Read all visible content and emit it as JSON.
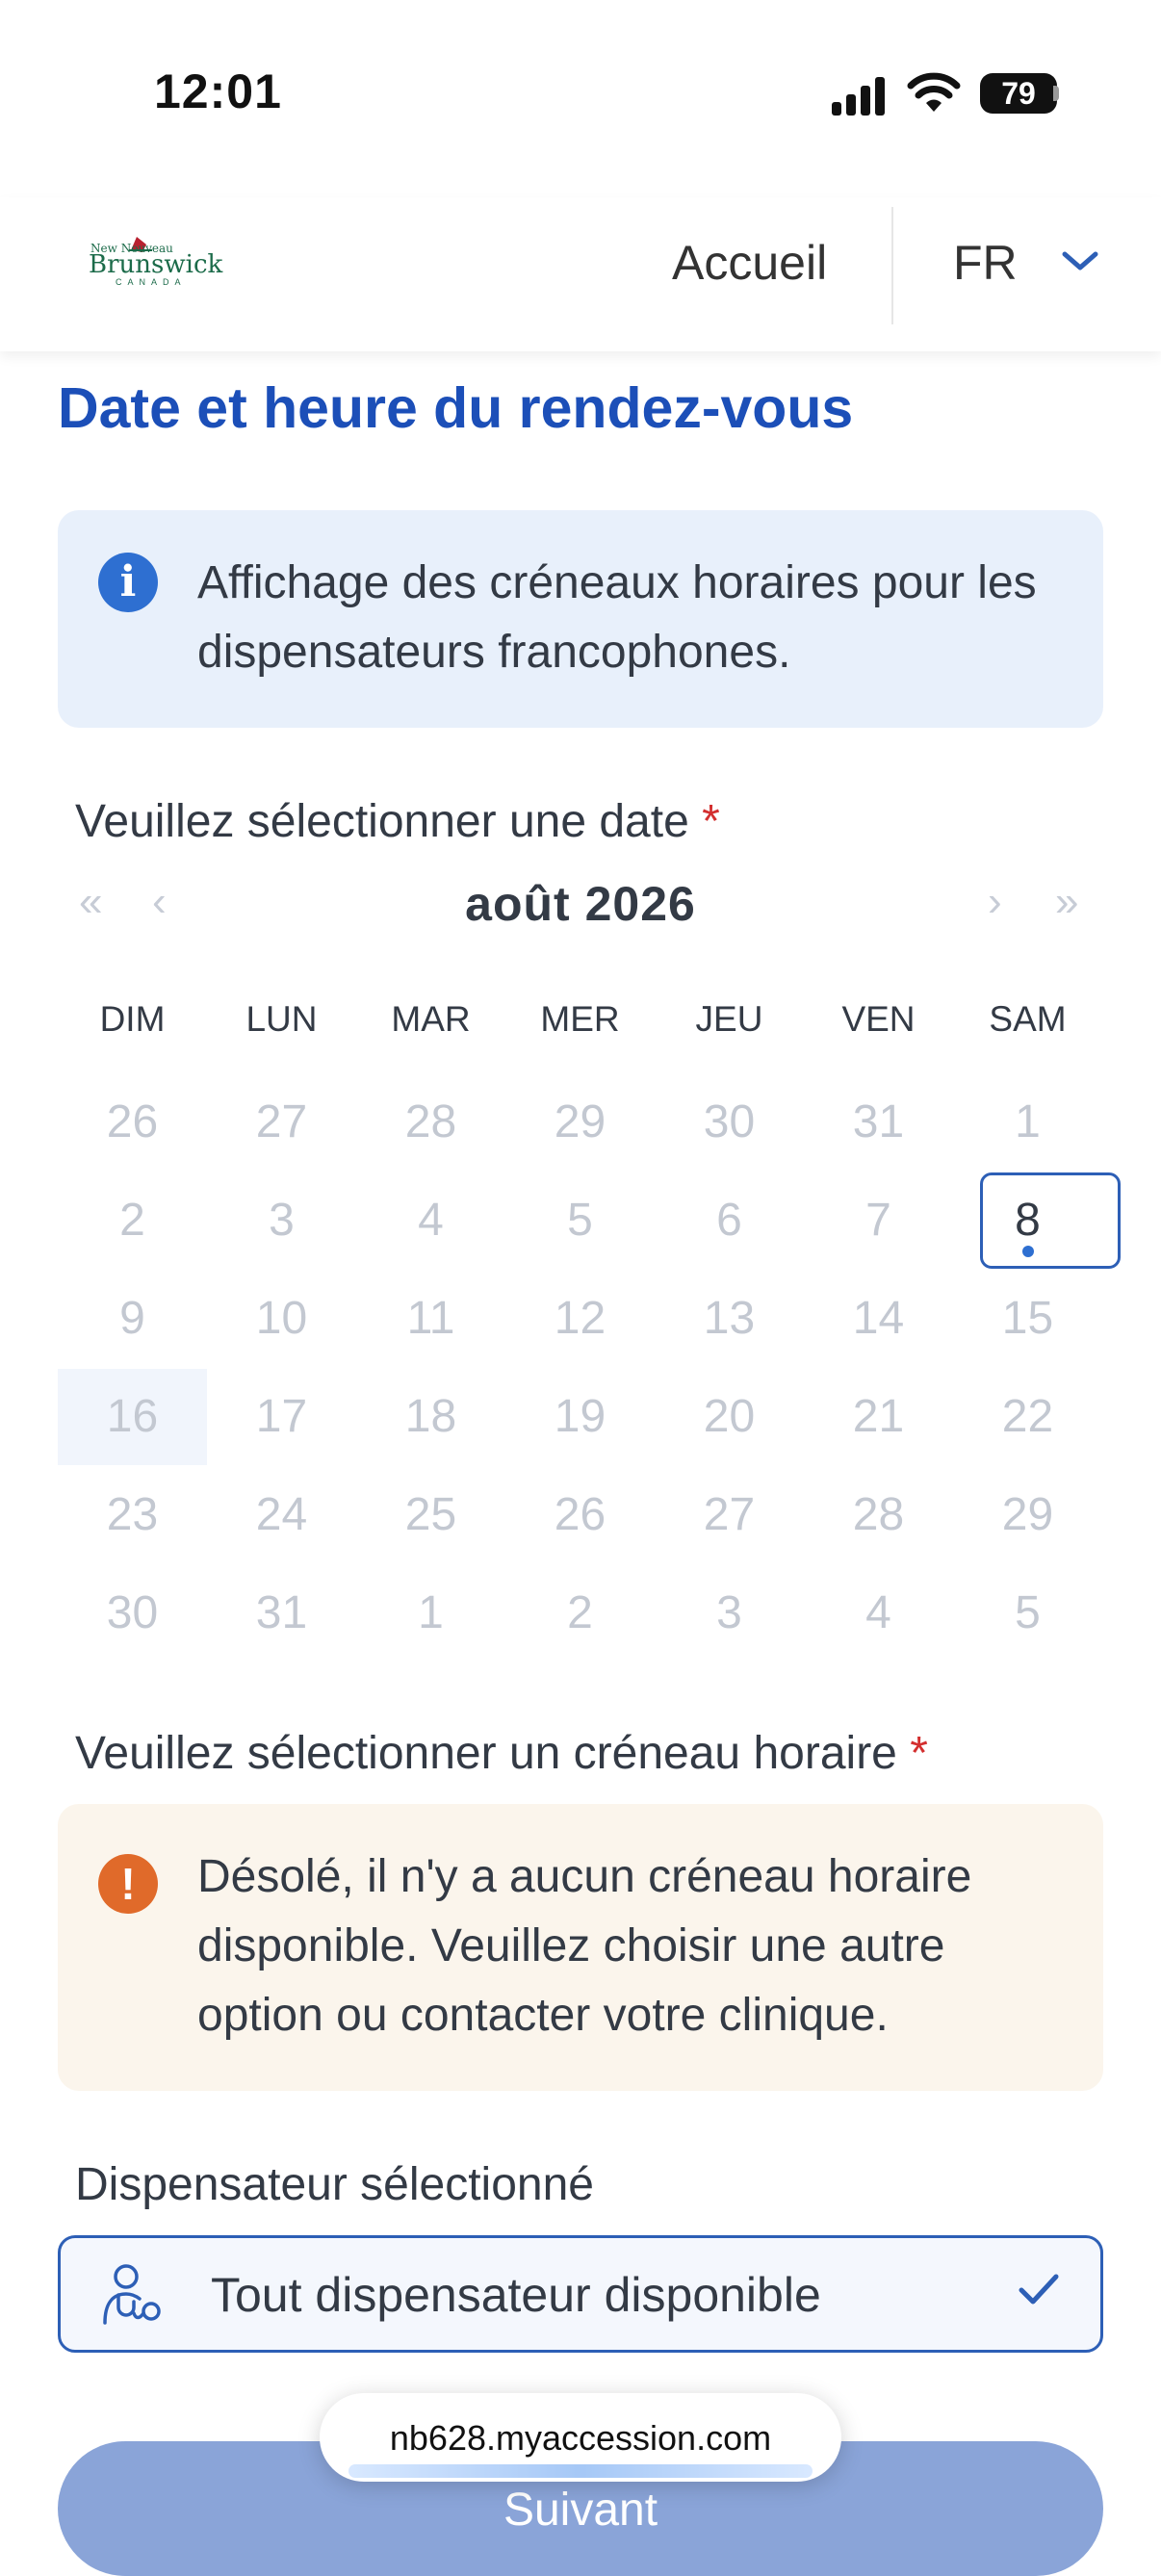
{
  "status_bar": {
    "time": "12:01",
    "battery": "79"
  },
  "header": {
    "logo_text": "Brunswick",
    "logo_subtext": "CANADA",
    "logo_small": "New Nouveau",
    "nav_home": "Accueil",
    "language": "FR"
  },
  "page_title": "Date et heure du rendez-vous",
  "info_box": {
    "icon": "info-icon",
    "text": "Affichage des créneaux horaires pour les dispensateurs francophones."
  },
  "date_section": {
    "label": "Veuillez sélectionner une date",
    "required_mark": "*",
    "nav": {
      "prev_year": "«",
      "prev_month": "‹",
      "next_month": "›",
      "next_year": "»"
    },
    "month": "août 2026",
    "weekdays": [
      "DIM",
      "LUN",
      "MAR",
      "MER",
      "JEU",
      "VEN",
      "SAM"
    ],
    "weeks": [
      [
        "26",
        "27",
        "28",
        "29",
        "30",
        "31",
        "1"
      ],
      [
        "2",
        "3",
        "4",
        "5",
        "6",
        "7",
        "8"
      ],
      [
        "9",
        "10",
        "11",
        "12",
        "13",
        "14",
        "15"
      ],
      [
        "16",
        "17",
        "18",
        "19",
        "20",
        "21",
        "22"
      ],
      [
        "23",
        "24",
        "25",
        "26",
        "27",
        "28",
        "29"
      ],
      [
        "30",
        "31",
        "1",
        "2",
        "3",
        "4",
        "5"
      ]
    ],
    "selected_day": "8",
    "highlighted_day": "16"
  },
  "slot_section": {
    "label": "Veuillez sélectionner un créneau horaire",
    "required_mark": "*",
    "warning_icon": "exclamation-icon",
    "warning_text": "Désolé, il n'y a aucun créneau horaire disponible. Veuillez choisir une autre option ou contacter votre clinique."
  },
  "provider_section": {
    "label": "Dispensateur sélectionné",
    "selected_value": "Tout dispensateur disponible",
    "icon": "stethoscope-doctor-icon"
  },
  "next_button": "Suivant",
  "url_bar": "nb628.myaccession.com",
  "colors": {
    "accent": "#1c4fb8",
    "border_accent": "#2d5fb6",
    "info_bg": "#e8f0fb",
    "warning_bg": "#fbf5ec",
    "warning_icon": "#e06a2a",
    "button": "#8aa4d8",
    "required": "#d32f2f"
  }
}
